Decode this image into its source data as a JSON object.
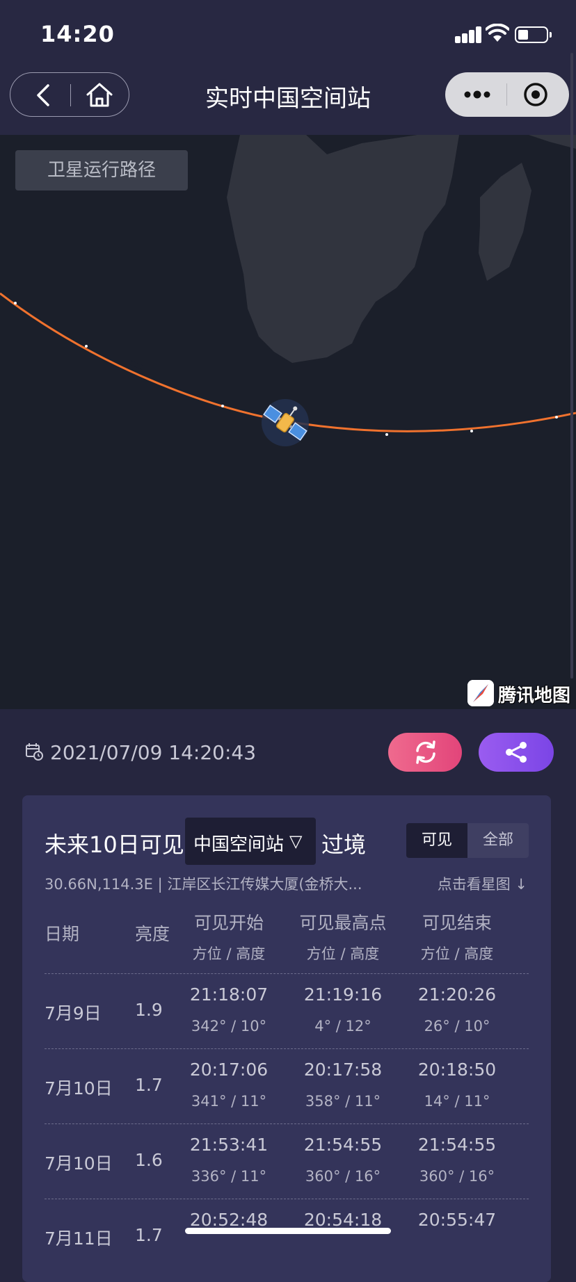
{
  "status_bar": {
    "time": "14:20"
  },
  "nav": {
    "title": "实时中国空间站"
  },
  "map": {
    "track_button": "卫星运行路径",
    "provider": "腾讯地图",
    "track_color": "#f0722e"
  },
  "info": {
    "datetime": "2021/07/09 14:20:43"
  },
  "passes": {
    "title_prefix": "未来10日可见",
    "satellite": "中国空间站",
    "select_arrow": "▽",
    "title_suffix": "过境",
    "tabs": {
      "visible": "可见",
      "all": "全部"
    },
    "location": "30.66N,114.3E | 江岸区长江传媒大厦(金桥大...",
    "starmap_link": "点击看星图 ↓",
    "headers": {
      "date": "日期",
      "magnitude": "亮度",
      "start": "可见开始",
      "peak": "可见最高点",
      "end": "可见结束",
      "sub": "方位 / 高度"
    },
    "rows": [
      {
        "date": "7月9日",
        "magnitude": "1.9",
        "start_time": "21:18:07",
        "start_pos": "342° / 10°",
        "peak_time": "21:19:16",
        "peak_pos": "4° / 12°",
        "end_time": "21:20:26",
        "end_pos": "26° / 10°"
      },
      {
        "date": "7月10日",
        "magnitude": "1.7",
        "start_time": "20:17:06",
        "start_pos": "341° / 11°",
        "peak_time": "20:17:58",
        "peak_pos": "358° / 11°",
        "end_time": "20:18:50",
        "end_pos": "14° / 11°"
      },
      {
        "date": "7月10日",
        "magnitude": "1.6",
        "start_time": "21:53:41",
        "start_pos": "336° / 11°",
        "peak_time": "21:54:55",
        "peak_pos": "360° / 16°",
        "end_time": "21:54:55",
        "end_pos": "360° / 16°"
      },
      {
        "date": "7月11日",
        "magnitude": "1.7",
        "start_time": "20:52:48",
        "start_pos": "",
        "peak_time": "20:54:18",
        "peak_pos": "",
        "end_time": "20:55:47",
        "end_pos": ""
      }
    ]
  }
}
